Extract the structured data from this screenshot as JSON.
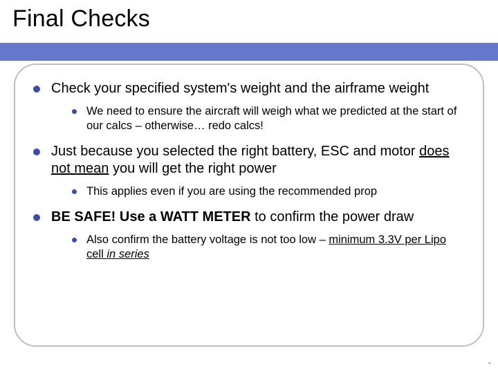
{
  "title": "Final Checks",
  "bullets": {
    "b1": {
      "text": "Check your specified system's weight and the airframe weight",
      "sub1": "We need to ensure the aircraft will weigh what we predicted at the start of our calcs – otherwise… redo calcs!"
    },
    "b2": {
      "pre": "Just because you selected the right battery, ESC and motor ",
      "u": "does not mean",
      "post": " you will get the right power",
      "sub1": "This applies even if you are using the recommended prop"
    },
    "b3": {
      "strong": "BE SAFE!  Use a WATT METER",
      "post": " to confirm the power draw",
      "sub1_pre": "Also confirm the battery voltage is not too low – ",
      "sub1_u1": "minimum 3.3V per Lipo cell ",
      "sub1_u2_i": "in series"
    }
  },
  "footer": "*"
}
